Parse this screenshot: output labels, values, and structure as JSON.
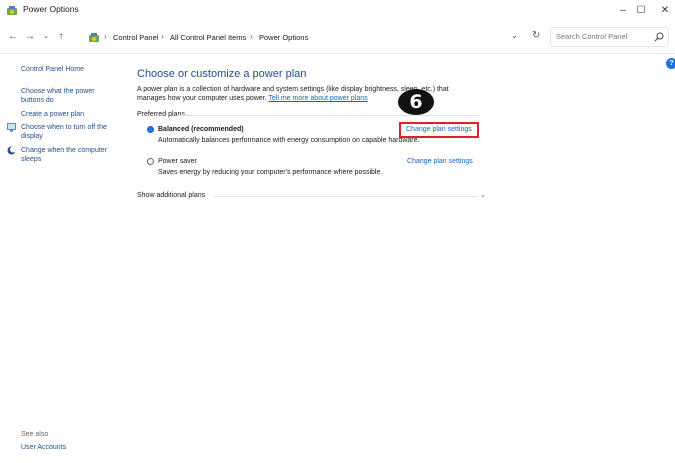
{
  "window": {
    "title": "Power Options",
    "controls": {
      "minimize": "–",
      "maximize": "☐",
      "close": "✕"
    }
  },
  "address_bar": {
    "breadcrumbs": [
      "Control Panel",
      "All Control Panel Items",
      "Power Options"
    ],
    "search_placeholder": "Search Control Panel"
  },
  "sidebar": {
    "items": [
      {
        "label": "Control Panel Home",
        "icon": null
      },
      {
        "label": "Choose what the power buttons do",
        "icon": null
      },
      {
        "label": "Create a power plan",
        "icon": null
      },
      {
        "label": "Choose when to turn off the display",
        "icon": "monitor-icon"
      },
      {
        "label": "Change when the computer sleeps",
        "icon": "moon-icon"
      }
    ],
    "see_also_label": "See also",
    "see_also_items": [
      {
        "label": "User Accounts"
      }
    ]
  },
  "main": {
    "heading": "Choose or customize a power plan",
    "description": "A power plan is a collection of hardware and system settings (like display brightness, sleep, etc.) that manages how your computer uses power.",
    "description_link": "Tell me more about power plans",
    "preferred_plans_label": "Preferred plans",
    "plans": [
      {
        "name": "Balanced (recommended)",
        "description": "Automatically balances performance with energy consumption on capable hardware.",
        "link": "Change plan settings",
        "selected": true
      },
      {
        "name": "Power saver",
        "description": "Saves energy by reducing your computer's performance where possible.",
        "link": "Change plan settings",
        "selected": false
      }
    ],
    "show_additional_label": "Show additional plans"
  },
  "annotation": {
    "step_number": "6",
    "highlight_color": "#e0202f"
  },
  "colors": {
    "link": "#1565c0",
    "heading": "#1f4d8f",
    "radio_selected": "#1a6ad6"
  }
}
